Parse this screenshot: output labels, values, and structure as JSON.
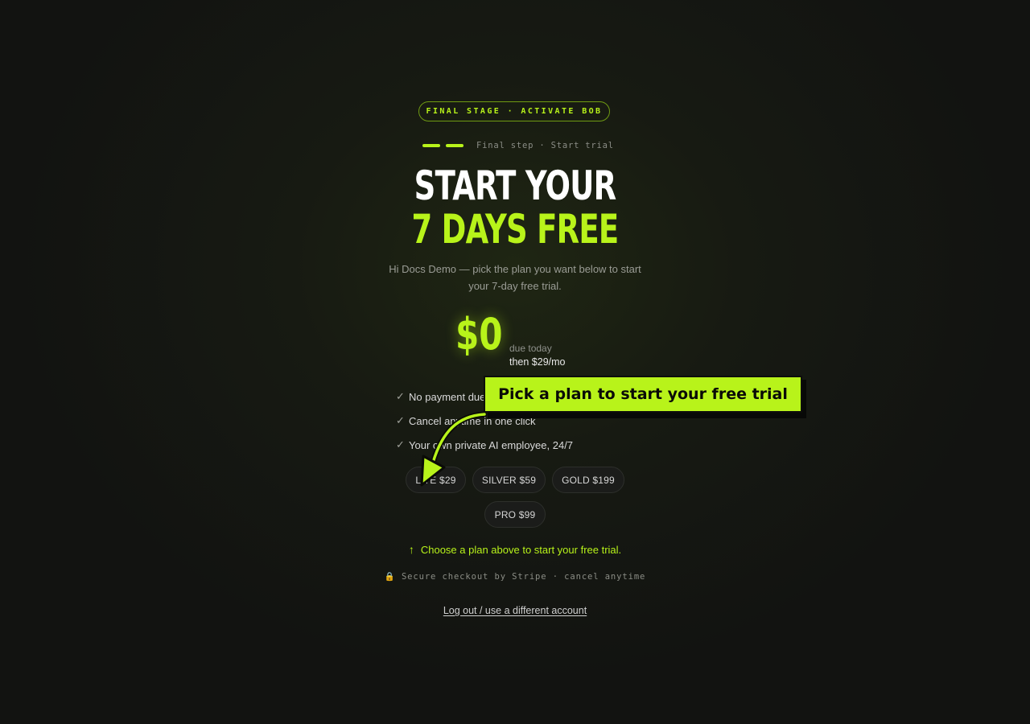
{
  "stage_badge": "FINAL STAGE · ACTIVATE BOB",
  "progress": {
    "steps_complete": 2,
    "label": "Final step · Start trial"
  },
  "headline": {
    "line1": "START YOUR",
    "line2": "7 DAYS FREE"
  },
  "subtitle": "Hi Docs Demo — pick the plan you want below to start your 7-day free trial.",
  "price": {
    "amount": "$0",
    "due_label": "due today",
    "then_label": "then $29/mo"
  },
  "benefits": [
    {
      "icon": "check-icon",
      "text": "No payment due today"
    },
    {
      "icon": "check-icon",
      "text": "Cancel anytime in one click"
    },
    {
      "icon": "check-icon",
      "text": "Your own private AI employee, 24/7"
    }
  ],
  "plans": [
    {
      "label": "LITE $29"
    },
    {
      "label": "SILVER $59"
    },
    {
      "label": "GOLD $199"
    },
    {
      "label": "PRO $99"
    }
  ],
  "choose_hint": {
    "icon": "arrow-up-icon",
    "text": "Choose a plan above to start your free trial."
  },
  "secure_note": {
    "icon": "lock-icon",
    "text": "Secure checkout by Stripe · cancel anytime"
  },
  "logout_link": "Log out / use a different account",
  "callout": {
    "text": "Pick a plan to start your free trial",
    "icon": "curved-arrow-icon"
  },
  "colors": {
    "accent": "#b8f31a",
    "background": "#151712",
    "muted_text": "#8b8d86"
  }
}
